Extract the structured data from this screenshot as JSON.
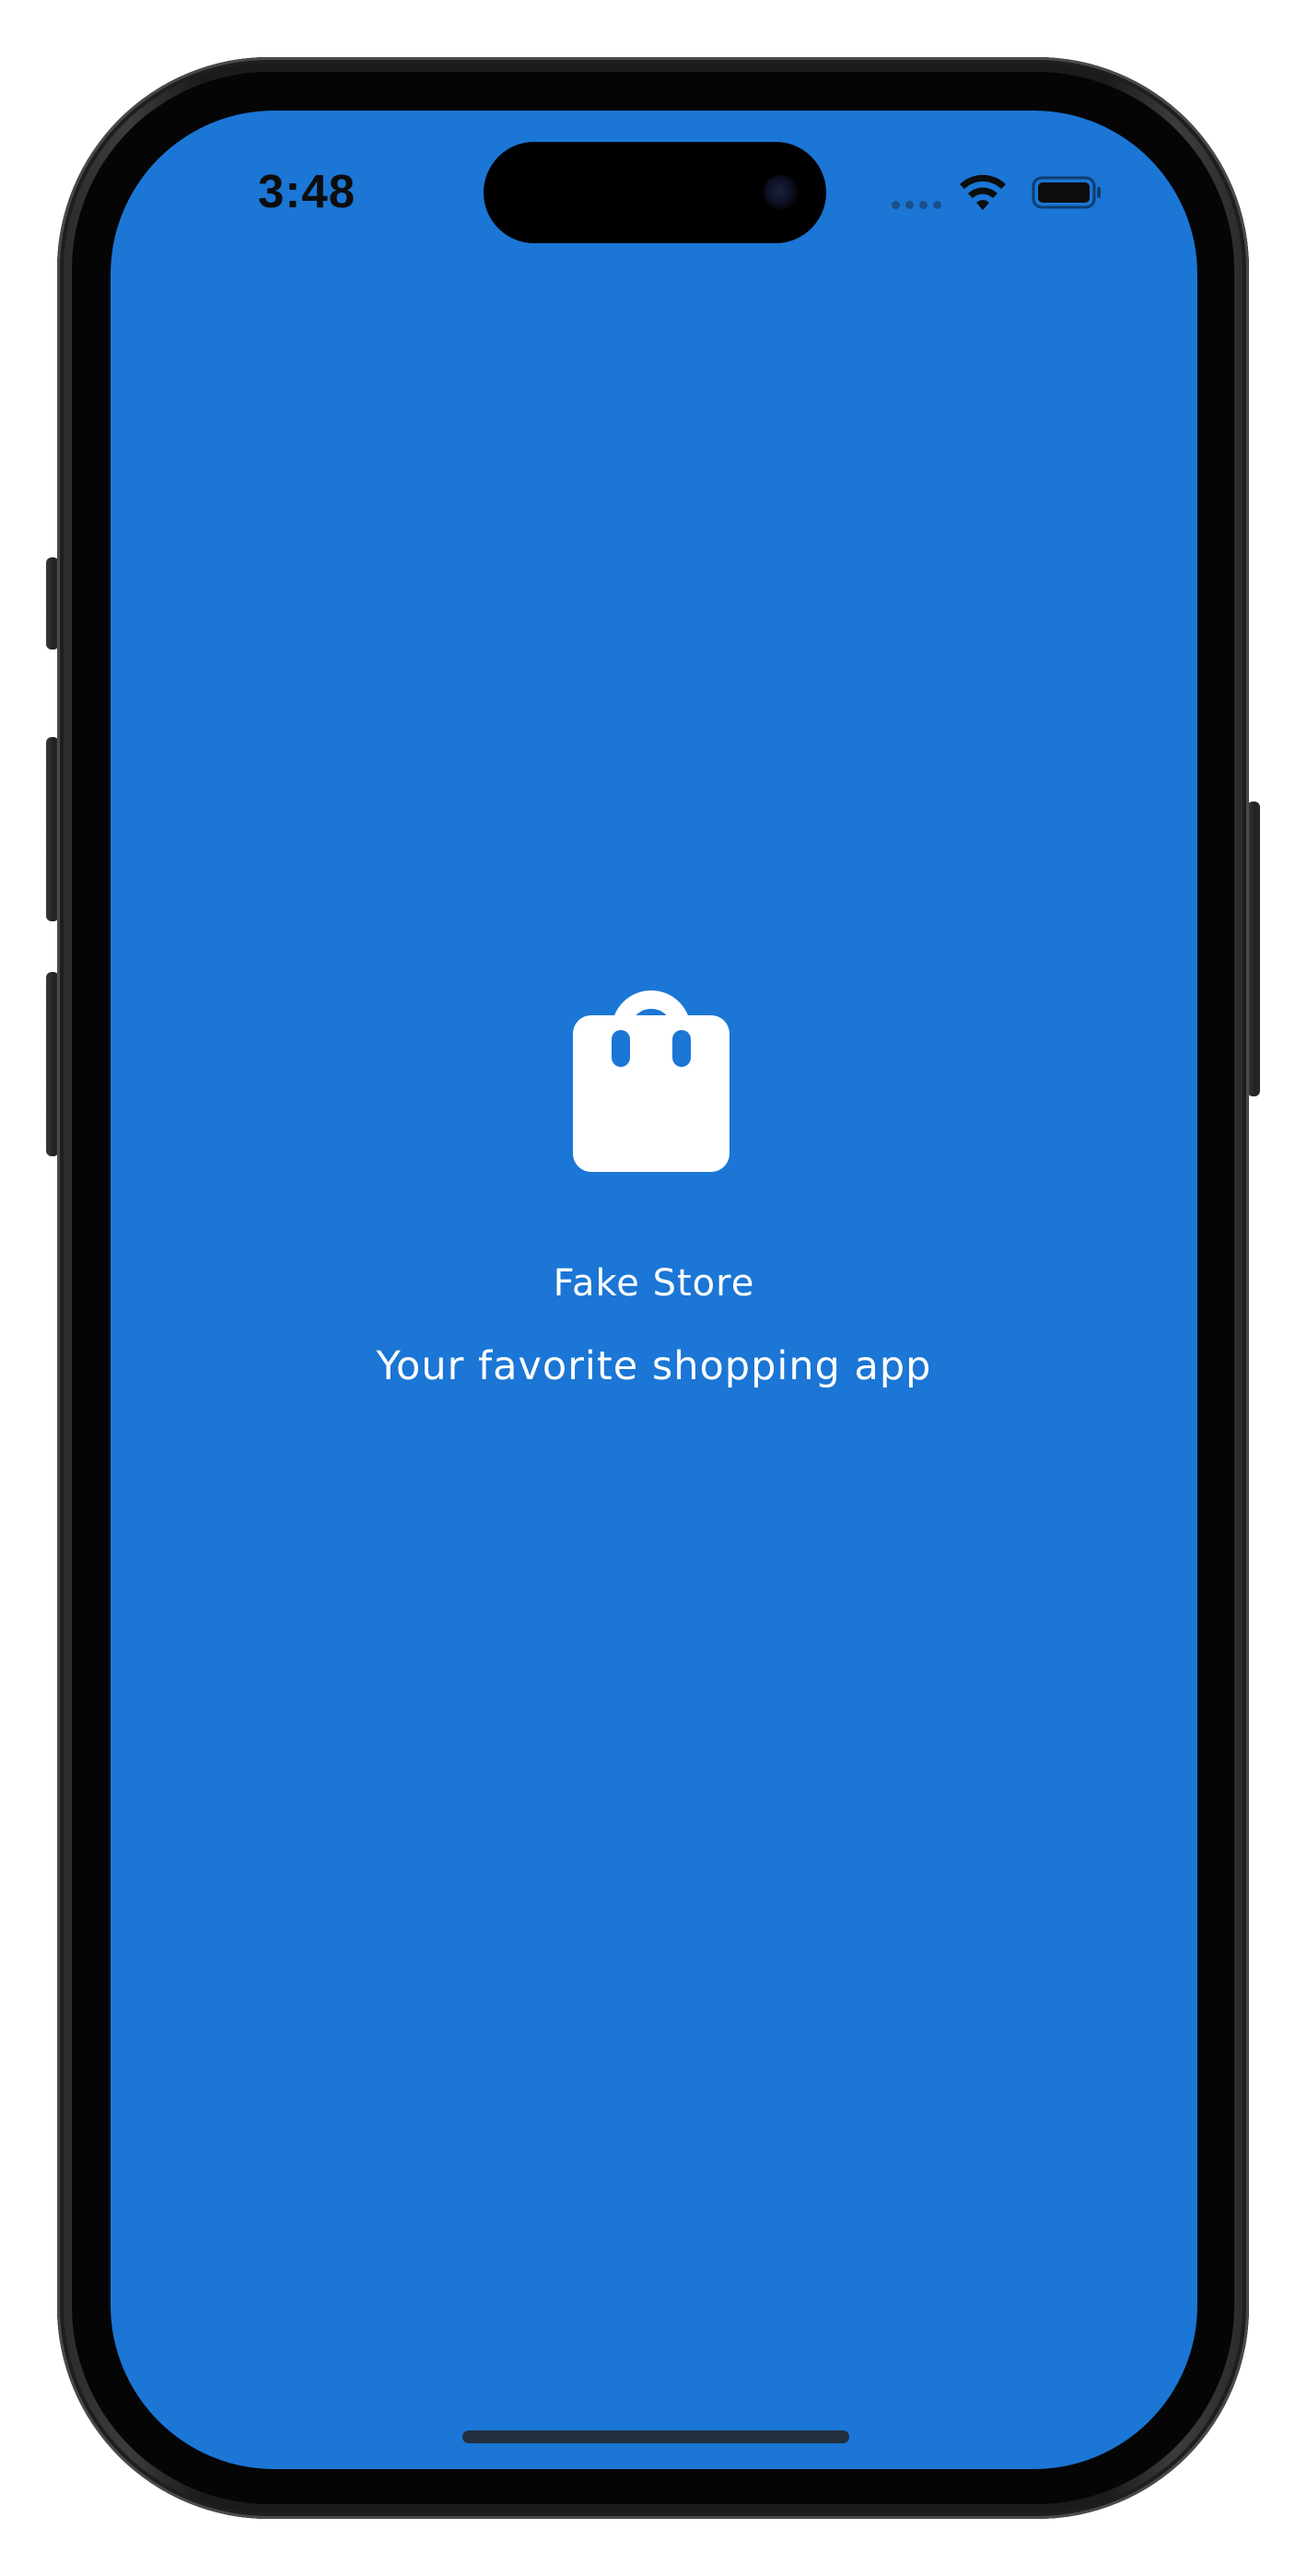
{
  "status_bar": {
    "time": "3:48",
    "icons": [
      "signal-dots-icon",
      "wifi-icon",
      "battery-icon"
    ]
  },
  "splash": {
    "icon": "shopping-bag-icon",
    "title": "Fake Store",
    "tagline": "Your favorite shopping app"
  },
  "colors": {
    "background": "#1b76d5",
    "foreground": "#ffffff"
  }
}
